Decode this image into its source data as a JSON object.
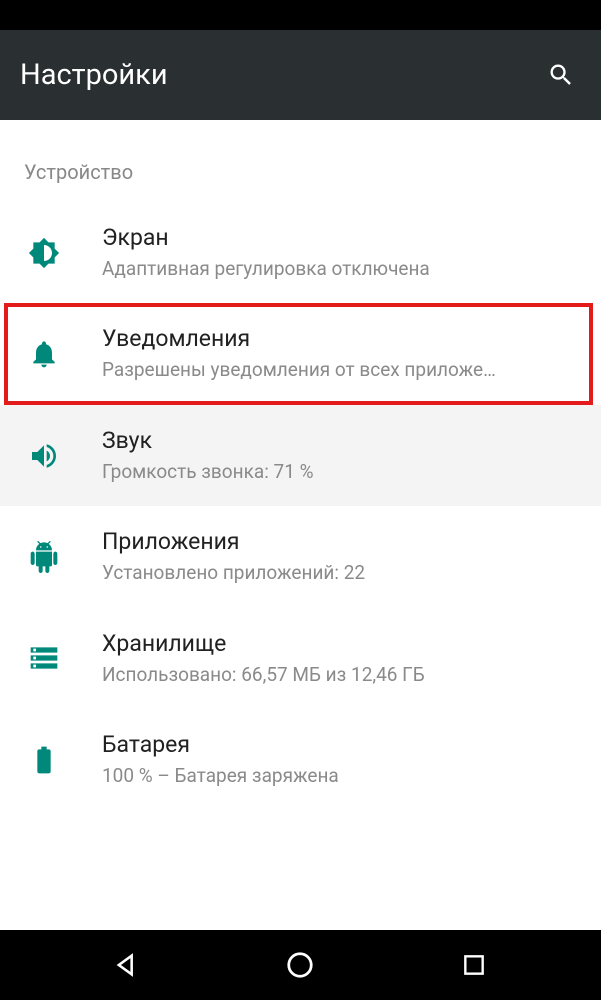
{
  "header": {
    "title": "Настройки"
  },
  "section": {
    "label": "Устройство"
  },
  "items": [
    {
      "title": "Экран",
      "subtitle": "Адаптивная регулировка отключена"
    },
    {
      "title": "Уведомления",
      "subtitle": "Разрешены уведомления от всех приложе…"
    },
    {
      "title": "Звук",
      "subtitle": "Громкость звонка: 71 %"
    },
    {
      "title": "Приложения",
      "subtitle": "Установлено приложений: 22"
    },
    {
      "title": "Хранилище",
      "subtitle": "Использовано: 66,57 МБ из 12,46 ГБ"
    },
    {
      "title": "Батарея",
      "subtitle": "100 % – Батарея заряжена"
    }
  ],
  "colors": {
    "accent": "#00897b",
    "highlight": "#e41b1b"
  }
}
